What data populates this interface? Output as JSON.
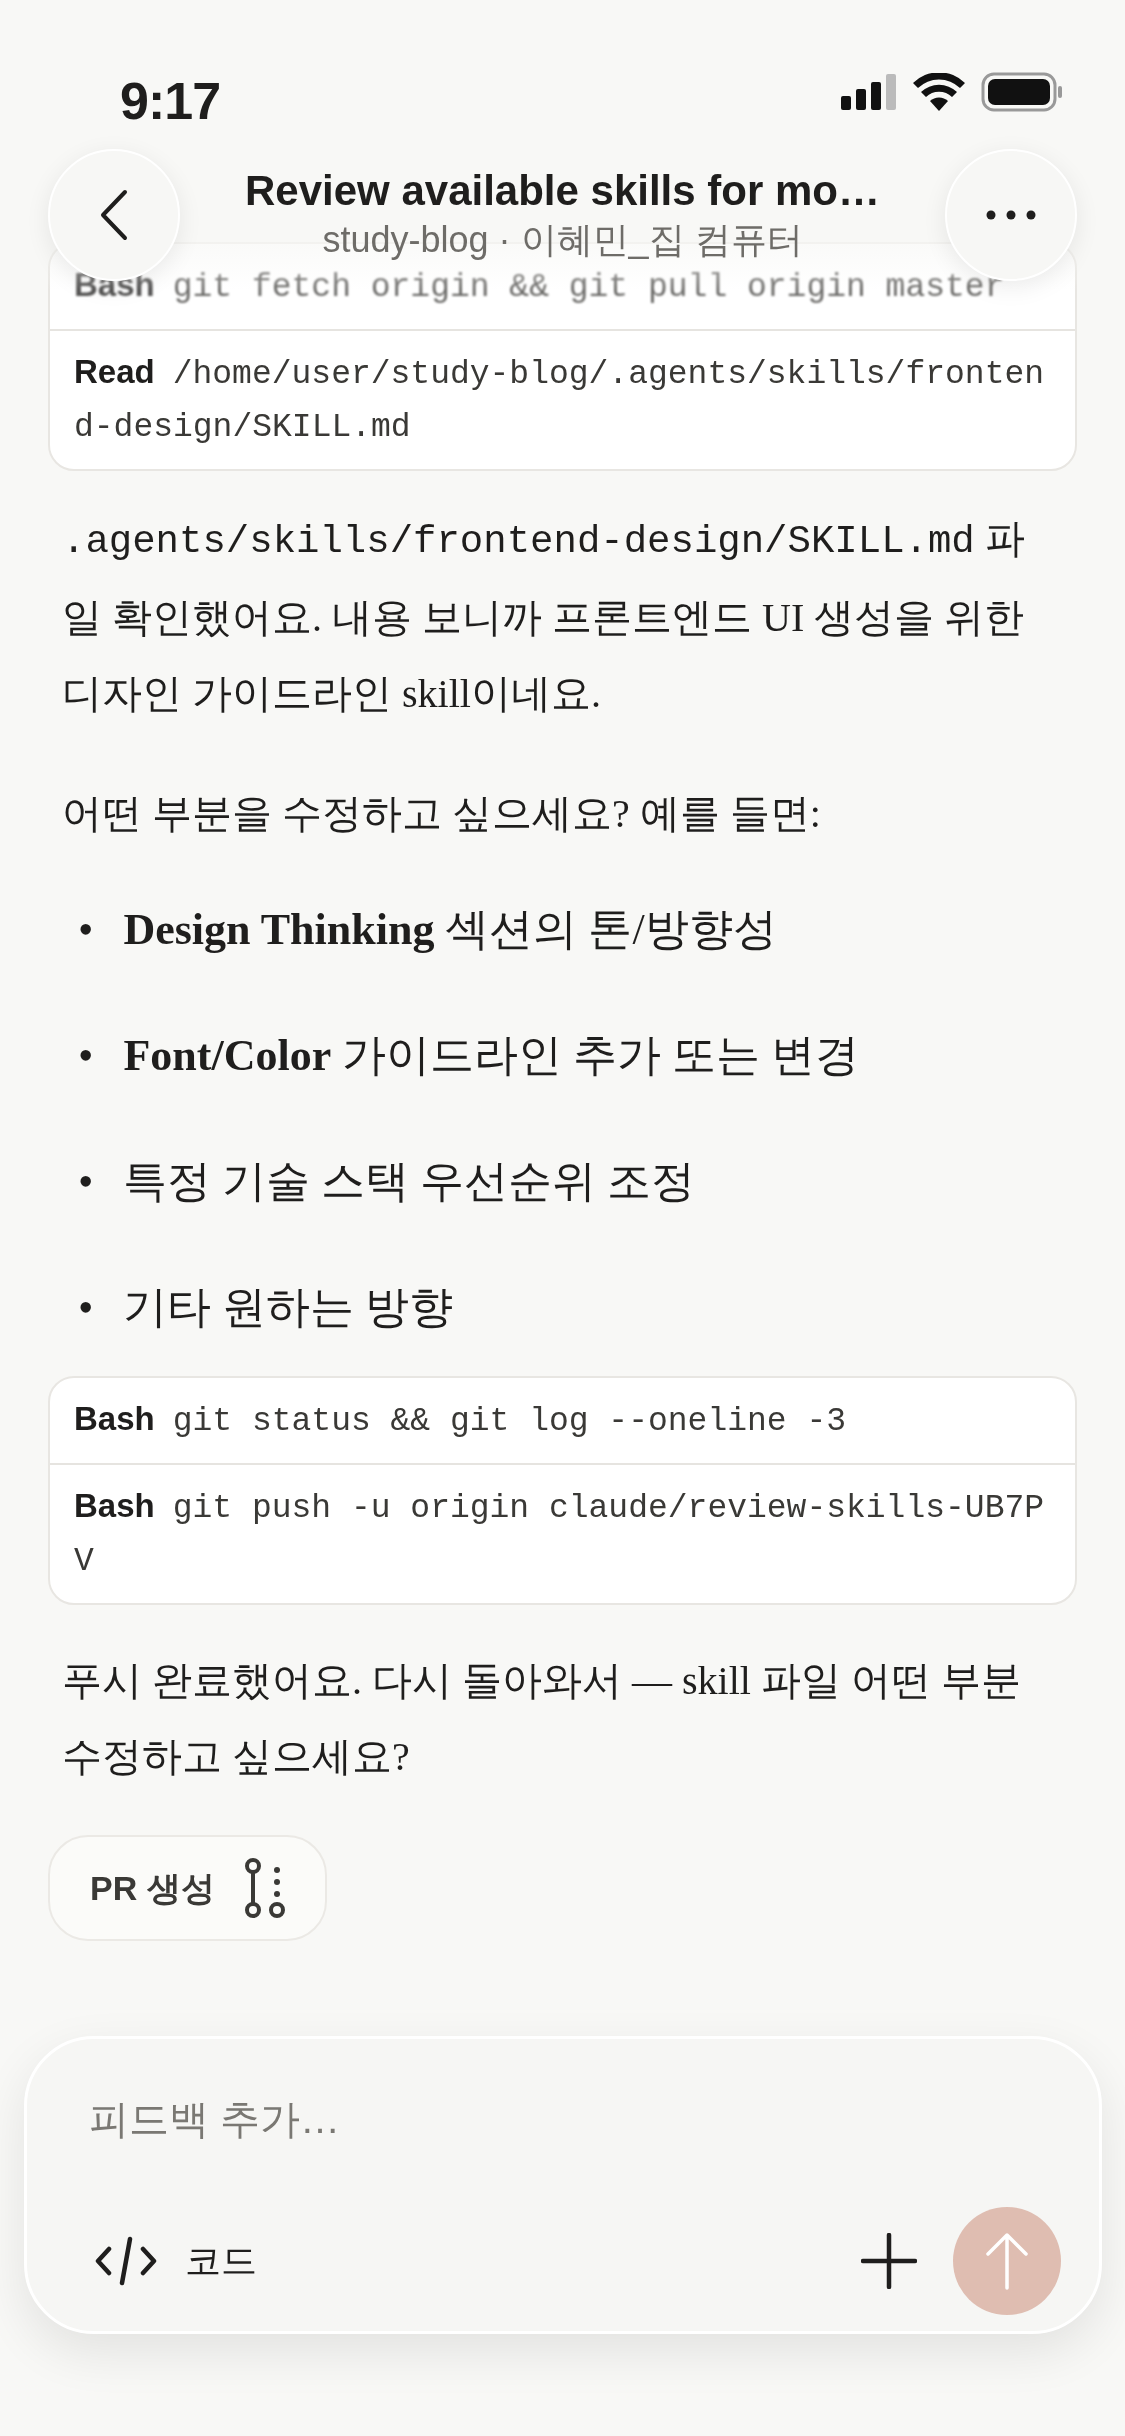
{
  "status_bar": {
    "time": "9:17"
  },
  "header": {
    "title": "Review available skills for mo…",
    "subtitle": "study-blog · 이혜민_집 컴퓨터"
  },
  "tool_cards": [
    {
      "rows": [
        {
          "tool": "Bash",
          "command": "git fetch origin && git pull origin master",
          "blurred": true
        },
        {
          "tool": "Read",
          "command": "/home/user/study-blog/.agents/skills/frontend-design/SKILL.md",
          "blurred": false
        }
      ]
    },
    {
      "rows": [
        {
          "tool": "Bash",
          "command": "git status && git log --oneline -3",
          "blurred": false
        },
        {
          "tool": "Bash",
          "command": "git push -u origin claude/review-skills-UB7PV",
          "blurred": false
        }
      ]
    }
  ],
  "messages": [
    {
      "kind": "paragraph",
      "parts": [
        {
          "kind": "code",
          "text": ".agents/skills/frontend-design/SKILL.md"
        },
        {
          "kind": "text",
          "text": " 파일 확인했어요. 내용 보니까 프론트엔드 UI 생성을 위한 디자인 가이드라인 skill이네요."
        }
      ]
    },
    {
      "kind": "paragraph",
      "parts": [
        {
          "kind": "text",
          "text": "어떤 부분을 수정하고 싶으세요? 예를 들면:"
        }
      ]
    },
    {
      "kind": "list",
      "items": [
        {
          "marker": "•",
          "text": "**Design Thinking** 섹션의 톤/방향성"
        },
        {
          "marker": "•",
          "text": "**Font/Color** 가이드라인 추가 또는 변경"
        },
        {
          "marker": "•",
          "text": "특정 기술 스택 우선순위 조정"
        },
        {
          "marker": "•",
          "text": "기타 원하는 방향"
        }
      ]
    },
    {
      "kind": "tools"
    },
    {
      "kind": "paragraph",
      "parts": [
        {
          "kind": "text",
          "text": "푸시 완료했어요. 다시 돌아와서 — skill 파일 어떤 부분 수정하고 싶으세요?"
        }
      ]
    }
  ],
  "pr_button": {
    "label": "PR 생성"
  },
  "composer": {
    "placeholder": "피드백 추가…",
    "mode_label": "코드",
    "send_disabled": true
  }
}
